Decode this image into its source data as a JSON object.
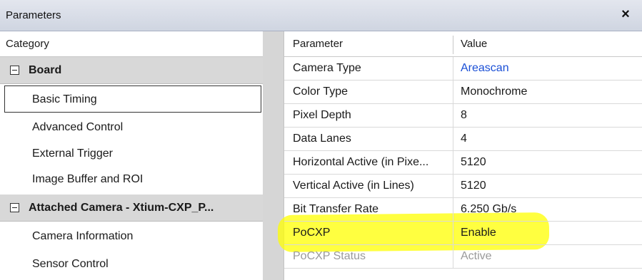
{
  "window": {
    "title": "Parameters",
    "close_symbol": "×"
  },
  "category_panel": {
    "header": "Category",
    "items": [
      {
        "label": "Board",
        "type": "group",
        "expanded_symbol": "−"
      },
      {
        "label": "Basic Timing",
        "type": "item",
        "selected": true
      },
      {
        "label": "Advanced Control",
        "type": "item"
      },
      {
        "label": "External Trigger",
        "type": "item"
      },
      {
        "label": "Image Buffer and ROI",
        "type": "item"
      },
      {
        "label": "Attached Camera - Xtium-CXP_P...",
        "type": "group"
      },
      {
        "label": "Camera Information",
        "type": "item"
      },
      {
        "label": "Sensor Control",
        "type": "item"
      }
    ]
  },
  "parameter_table": {
    "columns": [
      "Parameter",
      "Value"
    ],
    "rows": [
      {
        "name": "Camera Type",
        "value": "Areascan",
        "value_is_link": true
      },
      {
        "name": "Color Type",
        "value": "Monochrome"
      },
      {
        "name": "Pixel Depth",
        "value": "8"
      },
      {
        "name": "Data Lanes",
        "value": "4"
      },
      {
        "name": "Horizontal Active (in Pixe...",
        "value": "5120"
      },
      {
        "name": "Vertical Active (in Lines)",
        "value": "5120"
      },
      {
        "name": "Bit Transfer Rate",
        "value": "6.250 Gb/s"
      },
      {
        "name": "PoCXP",
        "value": "Enable"
      },
      {
        "name": "PoCXP Status",
        "value": "Active",
        "disabled": true
      }
    ]
  },
  "colors": {
    "highlight": "#ffff00",
    "link": "#1a4fd6",
    "group_bg": "#d8d8d8"
  }
}
